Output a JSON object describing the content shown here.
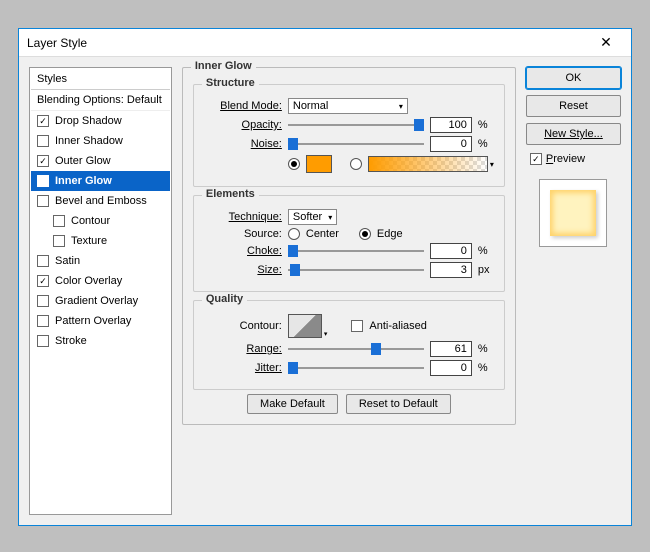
{
  "window": {
    "title": "Layer Style",
    "close": "✕"
  },
  "sidebar": {
    "header": "Styles",
    "subheader": "Blending Options: Default",
    "items": [
      {
        "label": "Drop Shadow",
        "checked": true,
        "selected": false,
        "indent": false
      },
      {
        "label": "Inner Shadow",
        "checked": false,
        "selected": false,
        "indent": false
      },
      {
        "label": "Outer Glow",
        "checked": true,
        "selected": false,
        "indent": false
      },
      {
        "label": "Inner Glow",
        "checked": true,
        "selected": true,
        "indent": false
      },
      {
        "label": "Bevel and Emboss",
        "checked": false,
        "selected": false,
        "indent": false
      },
      {
        "label": "Contour",
        "checked": false,
        "selected": false,
        "indent": true
      },
      {
        "label": "Texture",
        "checked": false,
        "selected": false,
        "indent": true
      },
      {
        "label": "Satin",
        "checked": false,
        "selected": false,
        "indent": false
      },
      {
        "label": "Color Overlay",
        "checked": true,
        "selected": false,
        "indent": false
      },
      {
        "label": "Gradient Overlay",
        "checked": false,
        "selected": false,
        "indent": false
      },
      {
        "label": "Pattern Overlay",
        "checked": false,
        "selected": false,
        "indent": false
      },
      {
        "label": "Stroke",
        "checked": false,
        "selected": false,
        "indent": false
      }
    ]
  },
  "panel": {
    "title": "Inner Glow",
    "structure": {
      "legend": "Structure",
      "blend_mode_label": "Blend Mode:",
      "blend_mode_value": "Normal",
      "opacity_label": "Opacity:",
      "opacity_value": "100",
      "opacity_unit": "%",
      "noise_label": "Noise:",
      "noise_value": "0",
      "noise_unit": "%",
      "color_radio_selected": true,
      "color_swatch": "#ff9c00",
      "gradient_radio_selected": false
    },
    "elements": {
      "legend": "Elements",
      "technique_label": "Technique:",
      "technique_value": "Softer",
      "source_label": "Source:",
      "source_center_label": "Center",
      "source_center_selected": false,
      "source_edge_label": "Edge",
      "source_edge_selected": true,
      "choke_label": "Choke:",
      "choke_value": "0",
      "choke_unit": "%",
      "size_label": "Size:",
      "size_value": "3",
      "size_unit": "px"
    },
    "quality": {
      "legend": "Quality",
      "contour_label": "Contour:",
      "aa_label": "Anti-aliased",
      "aa_checked": false,
      "range_label": "Range:",
      "range_value": "61",
      "range_unit": "%",
      "jitter_label": "Jitter:",
      "jitter_value": "0",
      "jitter_unit": "%"
    },
    "buttons": {
      "make_default": "Make Default",
      "reset_default": "Reset to Default"
    }
  },
  "right": {
    "ok": "OK",
    "reset": "Reset",
    "new_style": "New Style...",
    "preview_label": "Preview",
    "preview_checked": true
  }
}
